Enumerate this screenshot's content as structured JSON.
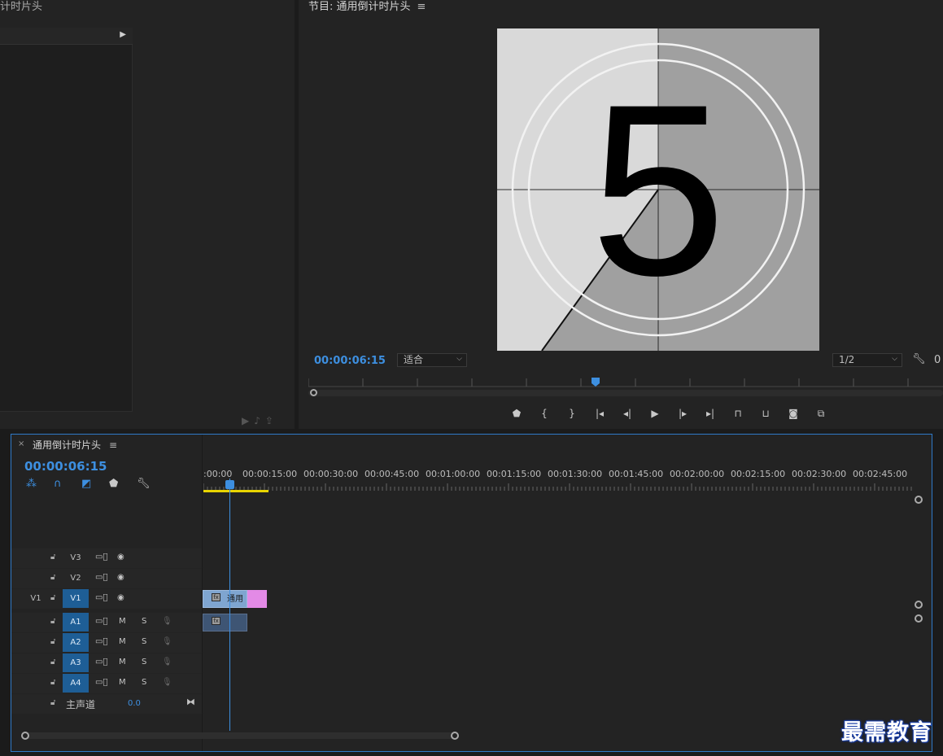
{
  "source_panel": {
    "title": "计时片头"
  },
  "program_monitor": {
    "title": "节目: 通用倒计时片头",
    "menu_glyph": "≡",
    "timecode": "00:00:06:15",
    "fit_option": "适合",
    "resolution": "1/2",
    "countdown_digit": "5",
    "transport_icons": [
      "marker-icon",
      "mark-in-icon",
      "mark-out-icon",
      "go-to-in-icon",
      "step-back-icon",
      "play-icon",
      "step-forward-icon",
      "go-to-out-icon",
      "lift-icon",
      "extract-icon",
      "export-frame-icon",
      "comparison-view-icon"
    ]
  },
  "timeline": {
    "close_glyph": "×",
    "title": "通用倒计时片头",
    "menu_glyph": "≡",
    "timecode": "00:00:06:15",
    "ruler_labels": [
      ":00:00",
      "00:00:15:00",
      "00:00:30:00",
      "00:00:45:00",
      "00:01:00:00",
      "00:01:15:00",
      "00:01:30:00",
      "00:01:45:00",
      "00:02:00:00",
      "00:02:15:00",
      "00:02:30:00",
      "00:02:45:00"
    ],
    "video_tracks": [
      {
        "name": "V3",
        "source_patch": "",
        "targeted": false
      },
      {
        "name": "V2",
        "source_patch": "",
        "targeted": false
      },
      {
        "name": "V1",
        "source_patch": "V1",
        "targeted": true
      }
    ],
    "audio_tracks": [
      {
        "name": "A1",
        "mute": "M",
        "solo": "S"
      },
      {
        "name": "A2",
        "mute": "M",
        "solo": "S"
      },
      {
        "name": "A3",
        "mute": "M",
        "solo": "S"
      },
      {
        "name": "A4",
        "mute": "M",
        "solo": "S"
      }
    ],
    "master": {
      "label": "主声道",
      "value": "0.0"
    },
    "clip_v1_label": "通用"
  },
  "watermark": "最需教育"
}
